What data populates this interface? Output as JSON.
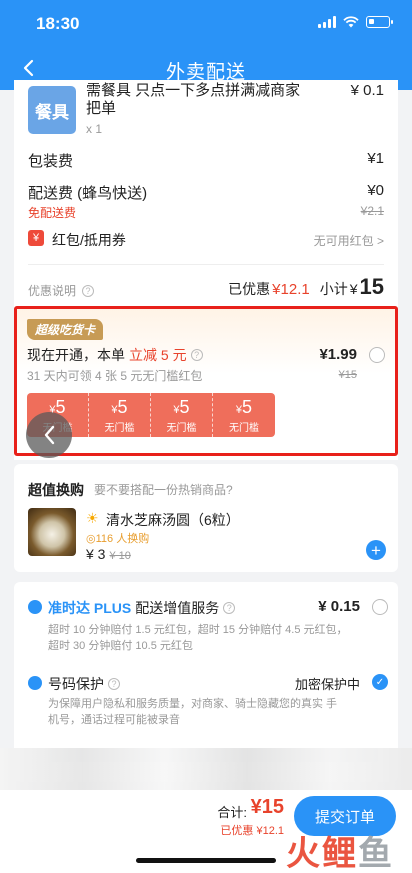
{
  "status_bar": {
    "time": "18:30"
  },
  "nav": {
    "title": "外卖配送"
  },
  "utensil": {
    "icon_text": "餐具",
    "name": "需餐具 只点一下多点拼满减商家把单",
    "qty": "x 1",
    "price": "¥ 0.1"
  },
  "fees": {
    "packaging_label": "包装费",
    "packaging_value": "¥1",
    "delivery_label": "配送费 (蜂鸟快送)",
    "delivery_value": "¥0",
    "free_delivery": "免配送费",
    "delivery_old": "¥2.1"
  },
  "coupon": {
    "icon": "¥",
    "label": "红包/抵用券",
    "value": "无可用红包 >"
  },
  "discount": {
    "info_label": "优惠说明",
    "saved_label": "已优惠",
    "saved_value": "¥12.1",
    "subtotal_label": "小计",
    "subtotal_currency": "¥",
    "subtotal_value": "15"
  },
  "vip": {
    "tag": "超级吃货卡",
    "title_prefix": "现在开通，本单",
    "title_highlight": "立减 5 元",
    "subtitle": "31 天内可领 4 张 5 元无门槛红包",
    "price": "¥1.99",
    "old_price": "¥15",
    "vouchers": [
      {
        "amount": "5",
        "currency": "¥",
        "condition": "无门槛"
      },
      {
        "amount": "5",
        "currency": "¥",
        "condition": "无门槛"
      },
      {
        "amount": "5",
        "currency": "¥",
        "condition": "无门槛"
      },
      {
        "amount": "5",
        "currency": "¥",
        "condition": "无门槛"
      }
    ]
  },
  "swap": {
    "title": "超值换购",
    "subtitle": "要不要搭配一份热销商品?",
    "item_name": "清水芝麻汤圆（6粒）",
    "buyers": "◎116 人换购",
    "price": "¥ 3",
    "old_price": "¥ 10"
  },
  "services": {
    "ontime_brand": "准时达 PLUS",
    "ontime_title": "配送增值服务",
    "ontime_price": "¥ 0.15",
    "ontime_desc": "超时 10 分钟赔付 1.5 元红包，超时 15 分钟赔付 4.5 元红包，超时 30 分钟赔付 10.5 元红包",
    "privacy_title": "号码保护",
    "privacy_state": "加密保护中",
    "privacy_desc": "为保障用户隐私和服务质量，对商家、骑士隐藏您的真实 手机号，通话过程可能被录音"
  },
  "bottom": {
    "total_label": "合计:",
    "total_value": "¥15",
    "saved": "已优惠 ¥12.1",
    "submit": "提交订单"
  },
  "watermark": {
    "text_red": "火鲤",
    "text_gray": "鱼"
  }
}
